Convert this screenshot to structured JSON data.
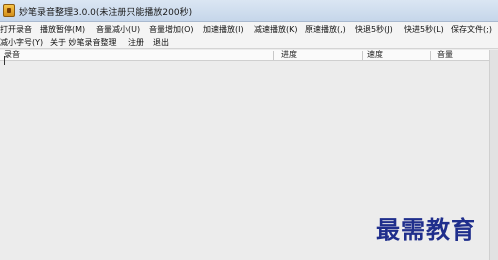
{
  "window": {
    "title": "妙笔录音整理3.0.0(未注册只能播放200秒)"
  },
  "menu": {
    "row1": [
      "打开录音",
      "播放暂停(M)",
      "音量减小(U)",
      "音量增加(O)",
      "加速播放(I)",
      "减速播放(K)",
      "原速播放(,)",
      "快退5秒(J)",
      "快进5秒(L)",
      "保存文件(;)"
    ],
    "row2": [
      "减小字号(Y)",
      "关于 妙笔录音整理",
      "注册",
      "退出"
    ]
  },
  "list": {
    "columns": [
      "录音",
      "进度",
      "速度",
      "音量"
    ]
  },
  "watermark": "最需教育"
}
